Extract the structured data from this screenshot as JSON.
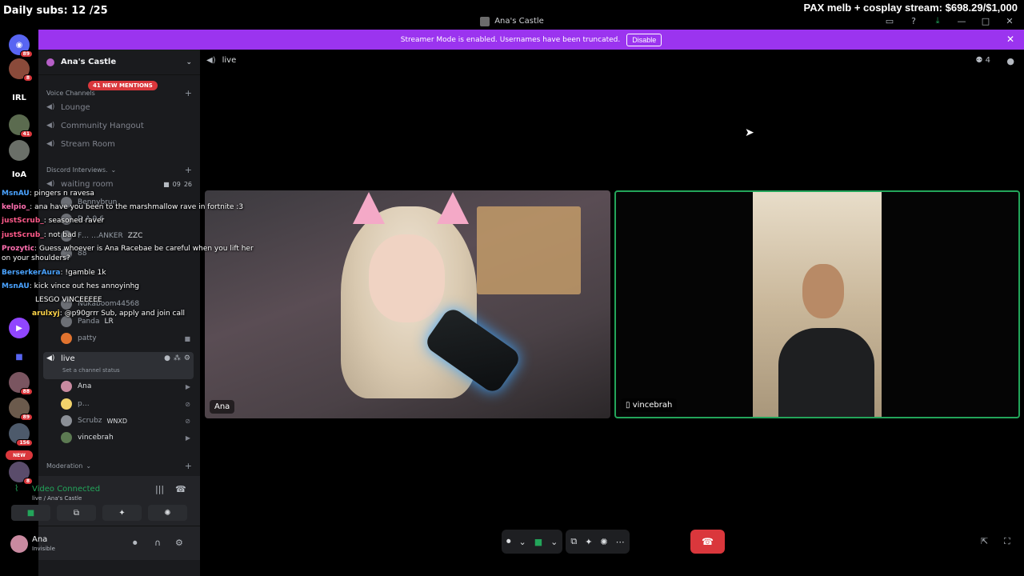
{
  "overlay": {
    "subs": "Daily subs: 12 /25",
    "goal": "PAX melb + cosplay stream: $698.29/$1,000"
  },
  "window": {
    "title": "Ana's Castle",
    "controls": [
      "▭",
      "?",
      "⤓",
      "—",
      "□",
      "✕"
    ]
  },
  "rail": {
    "badges": [
      "89",
      "8",
      "41",
      "88",
      "89",
      "156",
      "8"
    ],
    "labels": [
      "IRL",
      "IoA",
      "NEW"
    ]
  },
  "banner": {
    "text": "Streamer Mode is enabled. Usernames have been truncated.",
    "button": "Disable",
    "close": "✕"
  },
  "sidebar": {
    "guild": "Ana's Castle",
    "mentions": "41 NEW MENTIONS",
    "voice_category": "Voice Channels",
    "channels_top": [
      "Lounge",
      "Community Hangout",
      "Stream Room"
    ],
    "interviews_category": "Discord Interviews.",
    "waiting_room": "waiting room",
    "waiting_counts": [
      "09",
      "26"
    ],
    "hidden_users": [
      "Bennybrun",
      "D.A.9.6",
      "F… …ANKER",
      "88",
      "Nukaboom44568",
      "Panda",
      "patty"
    ],
    "hidden_tags": [
      "ZZC",
      "LR"
    ],
    "live_channel": "live",
    "status_hint": "Set a channel status",
    "live_users": [
      {
        "name": "Ana",
        "icon": "▶"
      },
      {
        "name": "p…",
        "icon": "⊘"
      },
      {
        "name": "Scrubz",
        "icon": "⊘"
      },
      {
        "name": "vincebrah",
        "icon": "▶"
      }
    ],
    "scrubz_tag": "WNXD",
    "moderation_category": "Moderation"
  },
  "voice_panel": {
    "title": "Video Connected",
    "subtitle": "live / Ana's Castle"
  },
  "user_panel": {
    "name": "Ana",
    "status": "Invisible"
  },
  "chat": [
    {
      "user": "MsnAU",
      "text": "pingers n ravesa",
      "color": "#4aa3ff"
    },
    {
      "user": "kelpio_",
      "text": "ana have you been to the marshmallow rave in fortnite :3",
      "color": "#ff6fb0"
    },
    {
      "user": "justScrub_",
      "text": "seasoned raver",
      "color": "#ff5a8a"
    },
    {
      "user": "justScrub_",
      "text": "not bad",
      "color": "#ff5a8a"
    },
    {
      "user": "Prozytic",
      "text": "Guess whoever is Ana Racebae be careful when you lift her",
      "color": "#ff6fb0"
    },
    {
      "user": "",
      "text": "on your shoulders?",
      "color": "#ffffff"
    },
    {
      "user": "BerserkerAura",
      "text": "!gamble 1k",
      "color": "#4aa3ff"
    },
    {
      "user": "MsnAU",
      "text": "kick vince out hes annoyinhg",
      "color": "#4aa3ff"
    },
    {
      "user": "",
      "text": "LESGO VINCEEEEE",
      "color": "#ffffff"
    },
    {
      "user": "arulxyj",
      "text": "@p90grrr Sub, apply and join call",
      "color": "#ffd54a"
    }
  ],
  "call": {
    "channel": "live",
    "participants": "4",
    "tiles": [
      {
        "label": "Ana"
      },
      {
        "label": "vincebrah"
      }
    ]
  }
}
